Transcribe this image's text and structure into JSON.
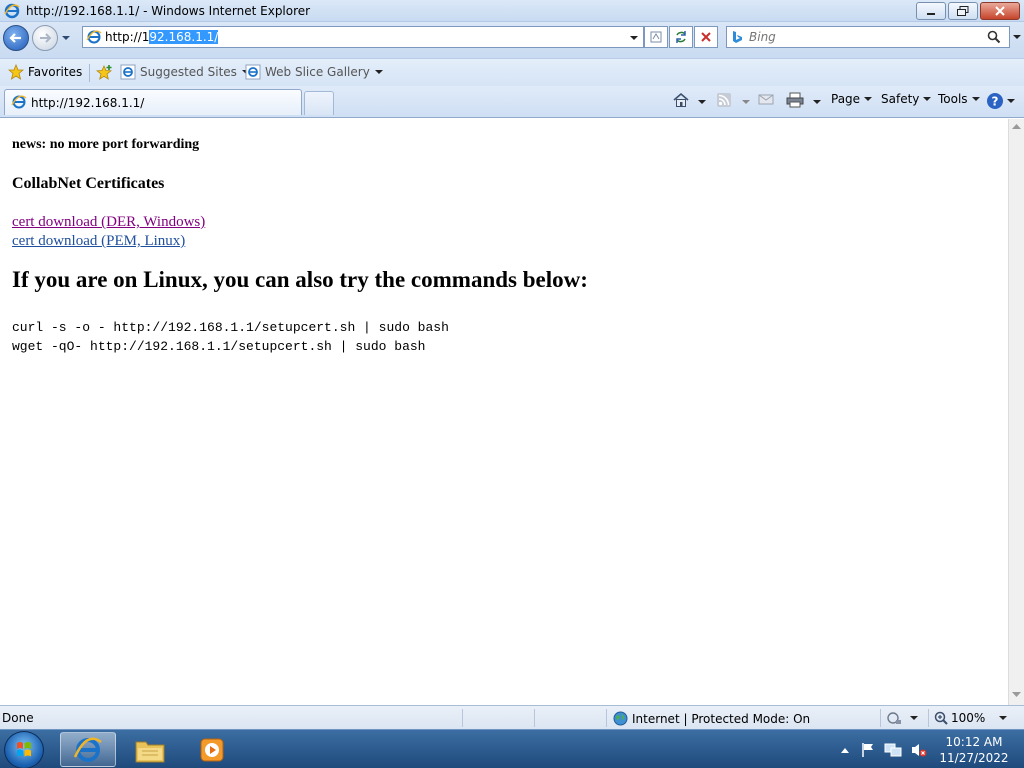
{
  "window": {
    "title": "http://192.168.1.1/ - Windows Internet Explorer"
  },
  "address": {
    "prefix": "http://1",
    "selected": "92.168.1.1/"
  },
  "search": {
    "placeholder": "Bing"
  },
  "favorites": {
    "label": "Favorites",
    "items": [
      {
        "label": "Suggested Sites"
      },
      {
        "label": "Web Slice Gallery"
      }
    ]
  },
  "tab": {
    "title": "http://192.168.1.1/"
  },
  "commands": {
    "page": "Page",
    "safety": "Safety",
    "tools": "Tools"
  },
  "content": {
    "news": "news: no more port forwarding",
    "heading": "CollabNet Certificates",
    "links": [
      "cert download (DER, Windows)",
      "cert download (PEM, Linux)"
    ],
    "big_heading": "If you are on Linux, you can also try the commands below:",
    "commands": [
      "curl -s -o - http://192.168.1.1/setupcert.sh | sudo bash",
      "wget -qO- http://192.168.1.1/setupcert.sh | sudo bash"
    ]
  },
  "status": {
    "left": "Done",
    "zone": "Internet | Protected Mode: On",
    "zoom": "100%"
  },
  "clock": {
    "time": "10:12 AM",
    "date": "11/27/2022"
  },
  "colors": {
    "visited_link": "#800080",
    "link": "#1e4e9c",
    "selection": "#3399ff"
  }
}
